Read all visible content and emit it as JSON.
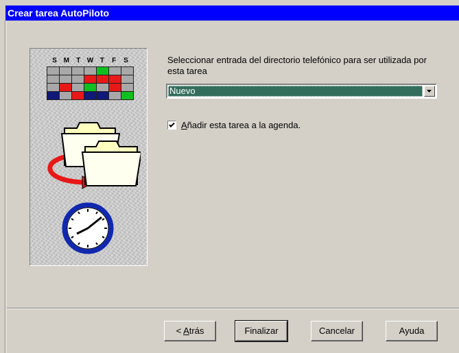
{
  "window": {
    "title": "Crear tarea AutoPiloto"
  },
  "calendar": {
    "days": [
      "S",
      "M",
      "T",
      "W",
      "T",
      "F",
      "S"
    ]
  },
  "main": {
    "instruction": "Seleccionar entrada del directorio telefónico para ser utilizada por esta tarea",
    "phonebook_select": {
      "selected": "Nuevo"
    },
    "schedule_checkbox": {
      "checked": true,
      "label_accel": "A",
      "label_rest": "ñadir esta tarea a la agenda."
    }
  },
  "buttons": {
    "back": {
      "prefix": "< ",
      "accel": "A",
      "rest": "trás"
    },
    "finish": "Finalizar",
    "cancel": "Cancelar",
    "help": "Ayuda"
  },
  "colors": {
    "titlebar": "#0000ff",
    "select_highlight": "#336e5c",
    "calendar_red": "#e81818",
    "calendar_green": "#10c020",
    "calendar_navy": "#101878",
    "folder_yellow": "#ffffc0",
    "clock_blue": "#1028b0"
  }
}
